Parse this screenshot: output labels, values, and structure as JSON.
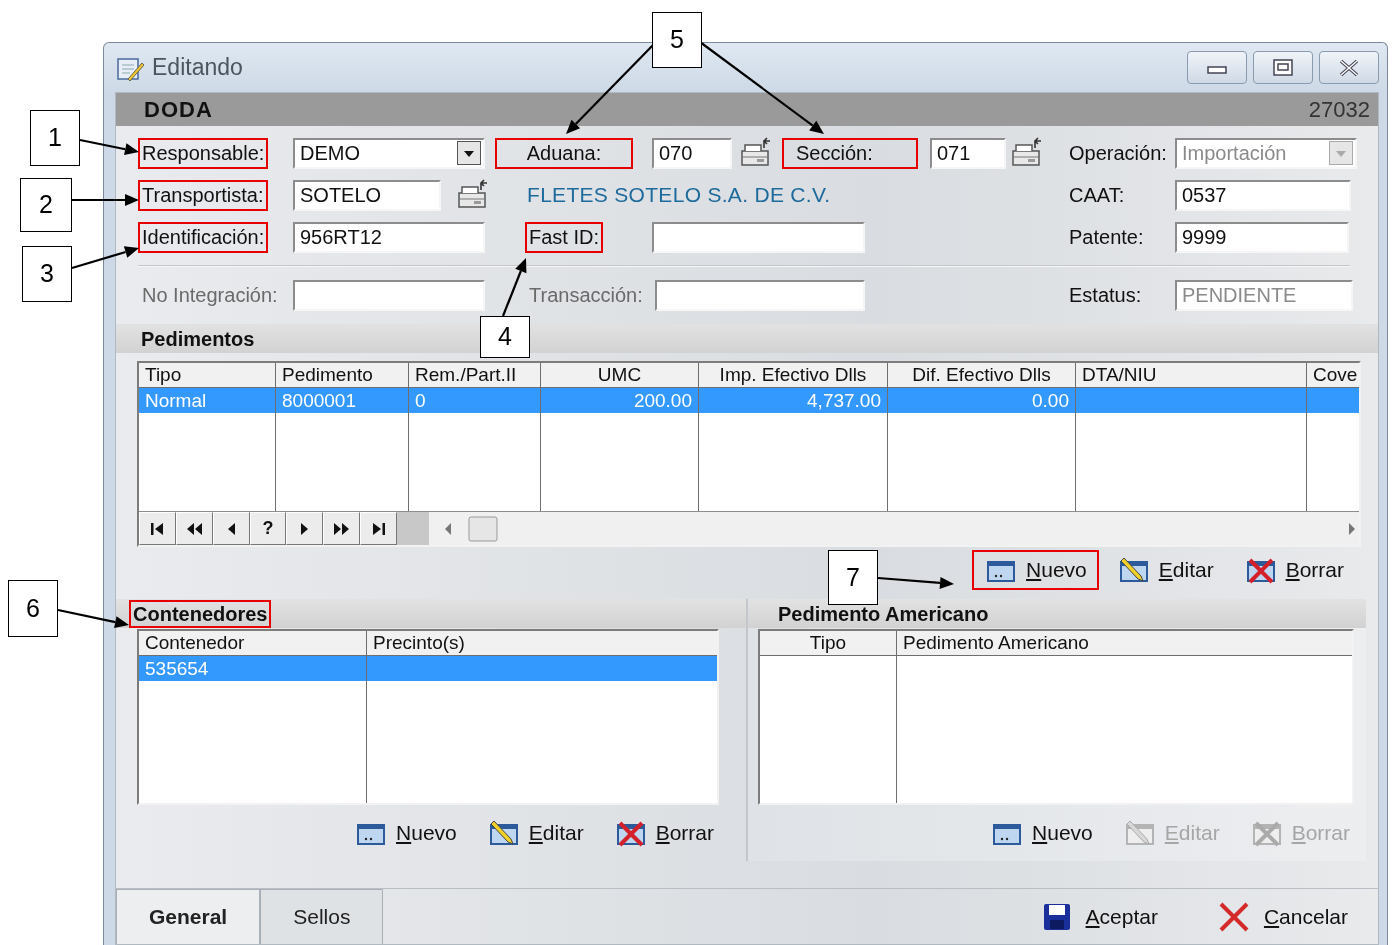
{
  "window": {
    "title": "Editando",
    "header": "DODA",
    "record_number": "27032"
  },
  "form": {
    "responsable": {
      "label": "Responsable:",
      "value": "DEMO",
      "highlighted": true,
      "disabled": false
    },
    "aduana": {
      "label": "Aduana:",
      "value": "070",
      "highlighted": true,
      "disabled": false
    },
    "seccion": {
      "label": "Sección:",
      "value": "071",
      "highlighted": true,
      "disabled": false
    },
    "operacion": {
      "label": "Operación:",
      "value": "Importación",
      "highlighted": false,
      "disabled": true
    },
    "transportista": {
      "label": "Transportista:",
      "value": "SOTELO",
      "highlighted": true,
      "disabled": false
    },
    "carrier_name": "FLETES SOTELO S.A. DE C.V.",
    "caat": {
      "label": "CAAT:",
      "value": "0537",
      "highlighted": false,
      "disabled": false
    },
    "identificacion": {
      "label": "Identificación:",
      "value": "956RT12",
      "highlighted": true,
      "disabled": false
    },
    "fast_id": {
      "label": "Fast ID:",
      "highlighted": true
    },
    "patente": {
      "label": "Patente:",
      "value": "9999",
      "highlighted": false,
      "disabled": false
    },
    "no_integracion": {
      "label": "No Integración:",
      "highlighted": false,
      "label_disabled": true
    },
    "transaccion": {
      "label": "Transacción:",
      "highlighted": false,
      "label_disabled": true
    },
    "estatus": {
      "label": "Estatus:",
      "value": "PENDIENTE",
      "highlighted": false,
      "disabled": true
    }
  },
  "pedimentos": {
    "title": "Pedimentos",
    "highlighted": false,
    "columns": [
      "Tipo",
      "Pedimento",
      "Rem./Part.II",
      "UMC",
      "Imp. Efectivo Dlls",
      "Dif. Efectivo Dlls",
      "DTA/NIU",
      "Cove"
    ],
    "rows": [
      {
        "cells": [
          "Normal",
          "8000001",
          "0",
          "200.00",
          "4,737.00",
          "0.00"
        ],
        "selected": true
      }
    ],
    "navigator": [
      {
        "kind": "first"
      },
      {
        "kind": "prev_page"
      },
      {
        "kind": "prev"
      },
      {
        "kind": "text",
        "label": "?"
      },
      {
        "kind": "next"
      },
      {
        "kind": "next_page"
      },
      {
        "kind": "last"
      }
    ],
    "actions": [
      {
        "kind": "new",
        "label": "Nuevo",
        "disabled": false,
        "highlighted": true
      },
      {
        "kind": "edit",
        "label": "Editar",
        "disabled": false,
        "highlighted": false
      },
      {
        "kind": "delete",
        "label": "Borrar",
        "disabled": false,
        "highlighted": false
      }
    ]
  },
  "contenedores": {
    "title": "Contenedores",
    "highlighted": true,
    "columns": [
      "Contenedor",
      "Precinto(s)"
    ],
    "rows": [
      {
        "cells": [
          "535654"
        ],
        "selected": true
      }
    ],
    "actions": [
      {
        "kind": "new",
        "label": "Nuevo",
        "disabled": false,
        "highlighted": false
      },
      {
        "kind": "edit",
        "label": "Editar",
        "disabled": false,
        "highlighted": false
      },
      {
        "kind": "delete",
        "label": "Borrar",
        "disabled": false,
        "highlighted": false
      }
    ]
  },
  "pedimento_americano": {
    "title": "Pedimento Americano",
    "highlighted": false,
    "columns": [
      "Tipo",
      "Pedimento Americano"
    ],
    "actions": [
      {
        "kind": "new",
        "label": "Nuevo",
        "disabled": false,
        "highlighted": false
      },
      {
        "kind": "edit",
        "label": "Editar",
        "disabled": true,
        "highlighted": false
      },
      {
        "kind": "delete",
        "label": "Borrar",
        "disabled": true,
        "highlighted": false
      }
    ]
  },
  "tabs": [
    {
      "label": "General",
      "selected": true
    },
    {
      "label": "Sellos",
      "selected": false
    }
  ],
  "dialog_buttons": [
    {
      "kind": "save",
      "label": "Aceptar"
    },
    {
      "kind": "cancel",
      "label": "Cancelar"
    }
  ],
  "callouts": [
    {
      "number": "1"
    },
    {
      "number": "2"
    },
    {
      "number": "3"
    },
    {
      "number": "4"
    },
    {
      "number": "5"
    },
    {
      "number": "6"
    },
    {
      "number": "7"
    }
  ]
}
